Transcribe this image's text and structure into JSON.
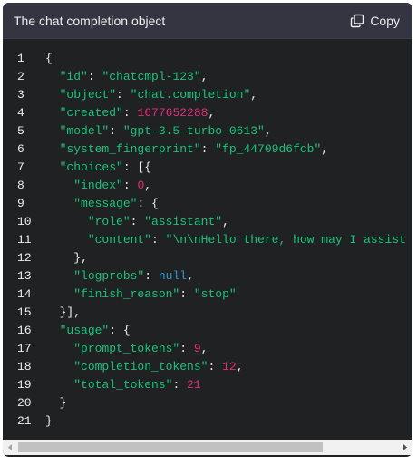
{
  "header": {
    "title": "The chat completion object",
    "copy_label": "Copy",
    "copy_icon": "copy-icon"
  },
  "code": {
    "language": "json",
    "lines": [
      {
        "num": "1",
        "tokens": [
          {
            "t": "p",
            "v": "{"
          }
        ]
      },
      {
        "num": "2",
        "tokens": [
          {
            "t": "p",
            "v": "  "
          },
          {
            "t": "k",
            "v": "\"id\""
          },
          {
            "t": "p",
            "v": ": "
          },
          {
            "t": "s",
            "v": "\"chatcmpl-123\""
          },
          {
            "t": "p",
            "v": ","
          }
        ]
      },
      {
        "num": "3",
        "tokens": [
          {
            "t": "p",
            "v": "  "
          },
          {
            "t": "k",
            "v": "\"object\""
          },
          {
            "t": "p",
            "v": ": "
          },
          {
            "t": "s",
            "v": "\"chat.completion\""
          },
          {
            "t": "p",
            "v": ","
          }
        ]
      },
      {
        "num": "4",
        "tokens": [
          {
            "t": "p",
            "v": "  "
          },
          {
            "t": "k",
            "v": "\"created\""
          },
          {
            "t": "p",
            "v": ": "
          },
          {
            "t": "n",
            "v": "1677652288"
          },
          {
            "t": "p",
            "v": ","
          }
        ]
      },
      {
        "num": "5",
        "tokens": [
          {
            "t": "p",
            "v": "  "
          },
          {
            "t": "k",
            "v": "\"model\""
          },
          {
            "t": "p",
            "v": ": "
          },
          {
            "t": "s",
            "v": "\"gpt-3.5-turbo-0613\""
          },
          {
            "t": "p",
            "v": ","
          }
        ]
      },
      {
        "num": "6",
        "tokens": [
          {
            "t": "p",
            "v": "  "
          },
          {
            "t": "k",
            "v": "\"system_fingerprint\""
          },
          {
            "t": "p",
            "v": ": "
          },
          {
            "t": "s",
            "v": "\"fp_44709d6fcb\""
          },
          {
            "t": "p",
            "v": ","
          }
        ]
      },
      {
        "num": "7",
        "tokens": [
          {
            "t": "p",
            "v": "  "
          },
          {
            "t": "k",
            "v": "\"choices\""
          },
          {
            "t": "p",
            "v": ": [{"
          }
        ]
      },
      {
        "num": "8",
        "tokens": [
          {
            "t": "p",
            "v": "    "
          },
          {
            "t": "k",
            "v": "\"index\""
          },
          {
            "t": "p",
            "v": ": "
          },
          {
            "t": "n",
            "v": "0"
          },
          {
            "t": "p",
            "v": ","
          }
        ]
      },
      {
        "num": "9",
        "tokens": [
          {
            "t": "p",
            "v": "    "
          },
          {
            "t": "k",
            "v": "\"message\""
          },
          {
            "t": "p",
            "v": ": {"
          }
        ]
      },
      {
        "num": "10",
        "tokens": [
          {
            "t": "p",
            "v": "      "
          },
          {
            "t": "k",
            "v": "\"role\""
          },
          {
            "t": "p",
            "v": ": "
          },
          {
            "t": "s",
            "v": "\"assistant\""
          },
          {
            "t": "p",
            "v": ","
          }
        ]
      },
      {
        "num": "11",
        "tokens": [
          {
            "t": "p",
            "v": "      "
          },
          {
            "t": "k",
            "v": "\"content\""
          },
          {
            "t": "p",
            "v": ": "
          },
          {
            "t": "s",
            "v": "\"\\n\\nHello there, how may I assist you today?\""
          },
          {
            "t": "p",
            "v": ","
          }
        ]
      },
      {
        "num": "12",
        "tokens": [
          {
            "t": "p",
            "v": "    },"
          }
        ]
      },
      {
        "num": "13",
        "tokens": [
          {
            "t": "p",
            "v": "    "
          },
          {
            "t": "k",
            "v": "\"logprobs\""
          },
          {
            "t": "p",
            "v": ": "
          },
          {
            "t": "kw",
            "v": "null"
          },
          {
            "t": "p",
            "v": ","
          }
        ]
      },
      {
        "num": "14",
        "tokens": [
          {
            "t": "p",
            "v": "    "
          },
          {
            "t": "k",
            "v": "\"finish_reason\""
          },
          {
            "t": "p",
            "v": ": "
          },
          {
            "t": "s",
            "v": "\"stop\""
          }
        ]
      },
      {
        "num": "15",
        "tokens": [
          {
            "t": "p",
            "v": "  }],"
          }
        ]
      },
      {
        "num": "16",
        "tokens": [
          {
            "t": "p",
            "v": "  "
          },
          {
            "t": "k",
            "v": "\"usage\""
          },
          {
            "t": "p",
            "v": ": {"
          }
        ]
      },
      {
        "num": "17",
        "tokens": [
          {
            "t": "p",
            "v": "    "
          },
          {
            "t": "k",
            "v": "\"prompt_tokens\""
          },
          {
            "t": "p",
            "v": ": "
          },
          {
            "t": "n",
            "v": "9"
          },
          {
            "t": "p",
            "v": ","
          }
        ]
      },
      {
        "num": "18",
        "tokens": [
          {
            "t": "p",
            "v": "    "
          },
          {
            "t": "k",
            "v": "\"completion_tokens\""
          },
          {
            "t": "p",
            "v": ": "
          },
          {
            "t": "n",
            "v": "12"
          },
          {
            "t": "p",
            "v": ","
          }
        ]
      },
      {
        "num": "19",
        "tokens": [
          {
            "t": "p",
            "v": "    "
          },
          {
            "t": "k",
            "v": "\"total_tokens\""
          },
          {
            "t": "p",
            "v": ": "
          },
          {
            "t": "n",
            "v": "21"
          }
        ]
      },
      {
        "num": "20",
        "tokens": [
          {
            "t": "p",
            "v": "  }"
          }
        ]
      },
      {
        "num": "21",
        "tokens": [
          {
            "t": "p",
            "v": "}"
          }
        ]
      }
    ]
  },
  "colors": {
    "background": "#202123",
    "header_background": "#343541",
    "key_string": "#19c37d",
    "number": "#df3079",
    "keyword": "#2e95d3",
    "text": "#ececf1"
  },
  "scrollbar": {
    "left_arrow_icon": "triangle-left-icon",
    "right_arrow_icon": "triangle-right-icon"
  }
}
